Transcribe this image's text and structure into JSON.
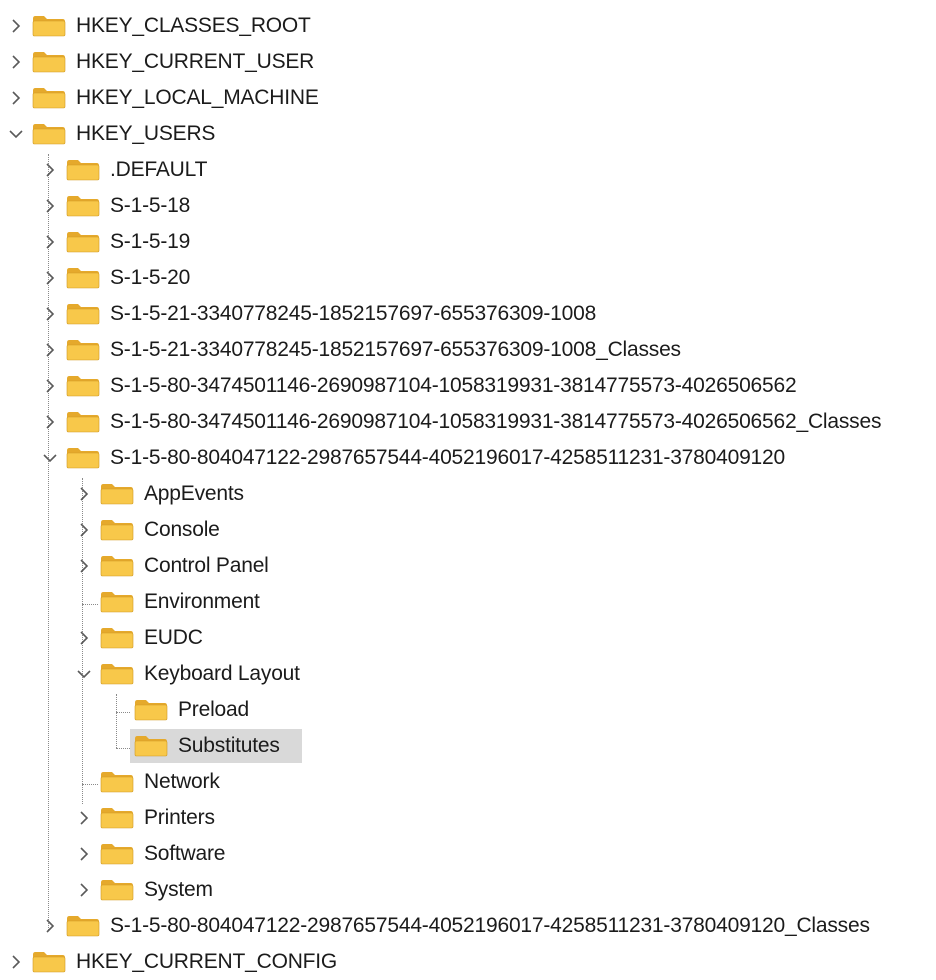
{
  "tree": {
    "nodes": [
      {
        "name": "node-hkey-classes-root",
        "label": "HKEY_CLASSES_ROOT",
        "depth": 0,
        "state": "collapsed"
      },
      {
        "name": "node-hkey-current-user",
        "label": "HKEY_CURRENT_USER",
        "depth": 0,
        "state": "collapsed"
      },
      {
        "name": "node-hkey-local-machine",
        "label": "HKEY_LOCAL_MACHINE",
        "depth": 0,
        "state": "collapsed"
      },
      {
        "name": "node-hkey-users",
        "label": "HKEY_USERS",
        "depth": 0,
        "state": "expanded"
      },
      {
        "name": "node-default",
        "label": ".DEFAULT",
        "depth": 1,
        "state": "collapsed"
      },
      {
        "name": "node-s-1-5-18",
        "label": "S-1-5-18",
        "depth": 1,
        "state": "collapsed"
      },
      {
        "name": "node-s-1-5-19",
        "label": "S-1-5-19",
        "depth": 1,
        "state": "collapsed"
      },
      {
        "name": "node-s-1-5-20",
        "label": "S-1-5-20",
        "depth": 1,
        "state": "collapsed"
      },
      {
        "name": "node-s-1-5-21-1008",
        "label": "S-1-5-21-3340778245-1852157697-655376309-1008",
        "depth": 1,
        "state": "collapsed"
      },
      {
        "name": "node-s-1-5-21-1008-classes",
        "label": "S-1-5-21-3340778245-1852157697-655376309-1008_Classes",
        "depth": 1,
        "state": "collapsed"
      },
      {
        "name": "node-s-1-5-80-4026506562",
        "label": "S-1-5-80-3474501146-2690987104-1058319931-3814775573-4026506562",
        "depth": 1,
        "state": "collapsed"
      },
      {
        "name": "node-s-1-5-80-4026506562-classes",
        "label": "S-1-5-80-3474501146-2690987104-1058319931-3814775573-4026506562_Classes",
        "depth": 1,
        "state": "collapsed"
      },
      {
        "name": "node-s-1-5-80-3780409120",
        "label": "S-1-5-80-804047122-2987657544-4052196017-4258511231-3780409120",
        "depth": 1,
        "state": "expanded"
      },
      {
        "name": "node-appevents",
        "label": "AppEvents",
        "depth": 2,
        "state": "collapsed"
      },
      {
        "name": "node-console",
        "label": "Console",
        "depth": 2,
        "state": "collapsed"
      },
      {
        "name": "node-control-panel",
        "label": "Control Panel",
        "depth": 2,
        "state": "collapsed"
      },
      {
        "name": "node-environment",
        "label": "Environment",
        "depth": 2,
        "state": "leaf"
      },
      {
        "name": "node-eudc",
        "label": "EUDC",
        "depth": 2,
        "state": "collapsed"
      },
      {
        "name": "node-keyboard-layout",
        "label": "Keyboard Layout",
        "depth": 2,
        "state": "expanded"
      },
      {
        "name": "node-preload",
        "label": "Preload",
        "depth": 3,
        "state": "leaf"
      },
      {
        "name": "node-substitutes",
        "label": "Substitutes",
        "depth": 3,
        "state": "leaf",
        "selected": true
      },
      {
        "name": "node-network",
        "label": "Network",
        "depth": 2,
        "state": "leaf"
      },
      {
        "name": "node-printers",
        "label": "Printers",
        "depth": 2,
        "state": "collapsed"
      },
      {
        "name": "node-software",
        "label": "Software",
        "depth": 2,
        "state": "collapsed"
      },
      {
        "name": "node-system",
        "label": "System",
        "depth": 2,
        "state": "collapsed"
      },
      {
        "name": "node-s-1-5-80-3780409120-classes",
        "label": "S-1-5-80-804047122-2987657544-4052196017-4258511231-3780409120_Classes",
        "depth": 1,
        "state": "collapsed"
      },
      {
        "name": "node-hkey-current-config",
        "label": "HKEY_CURRENT_CONFIG",
        "depth": 0,
        "state": "collapsed"
      }
    ]
  },
  "colors": {
    "folder_body": "#f8c84a",
    "folder_back": "#e5a92c",
    "folder_edge": "#d19a23",
    "selection": "#d9d9d9",
    "chevron": "#5a5a5a",
    "text": "#1b1b1b"
  },
  "icons": {
    "folder": "folder-icon",
    "collapsed": "chevron-right-icon",
    "expanded": "chevron-down-icon"
  }
}
